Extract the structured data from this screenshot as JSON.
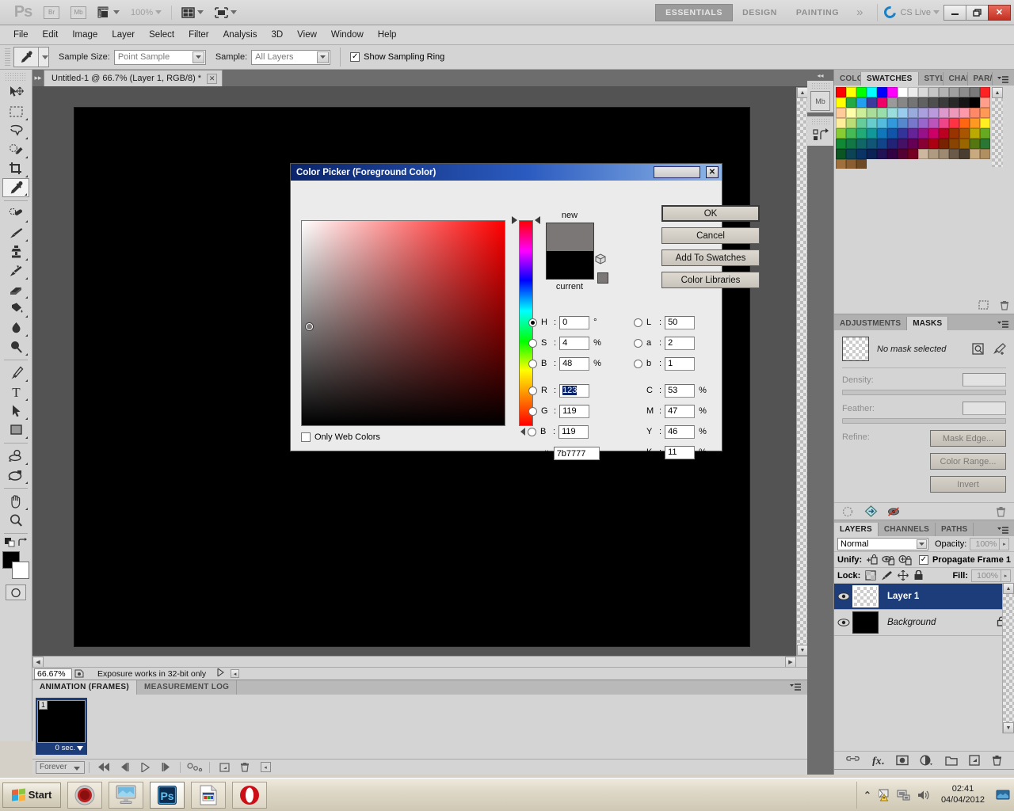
{
  "appbar": {
    "logo": "Ps",
    "bridge_btn": "Br",
    "minibridge_btn": "Mb",
    "zoom_level": "100%",
    "workspaces": [
      {
        "label": "ESSENTIALS",
        "active": true
      },
      {
        "label": "DESIGN",
        "active": false
      },
      {
        "label": "PAINTING",
        "active": false
      }
    ],
    "more_workspaces": "»",
    "cs_live": "CS Live",
    "window_buttons": {
      "minimize": "—",
      "restore": "❐",
      "close": "✕"
    }
  },
  "menubar": {
    "items": [
      "File",
      "Edit",
      "Image",
      "Layer",
      "Select",
      "Filter",
      "Analysis",
      "3D",
      "View",
      "Window",
      "Help"
    ]
  },
  "options_bar": {
    "tool": "eyedropper-tool",
    "sample_size_label": "Sample Size:",
    "sample_size_value": "Point Sample",
    "sample_label": "Sample:",
    "sample_value": "All Layers",
    "show_sampling_ring_label": "Show Sampling Ring",
    "show_sampling_ring_checked": true
  },
  "toolbar": {
    "tools": [
      {
        "name": "move-tool",
        "selected": false,
        "has_submenu": false
      },
      {
        "name": "rectangular-marquee-tool",
        "selected": false,
        "has_submenu": true
      },
      {
        "name": "lasso-tool",
        "selected": false,
        "has_submenu": true
      },
      {
        "name": "quick-selection-tool",
        "selected": false,
        "has_submenu": true
      },
      {
        "name": "crop-tool",
        "selected": false,
        "has_submenu": true
      },
      {
        "name": "eyedropper-tool",
        "selected": true,
        "has_submenu": true
      },
      {
        "name": "spot-healing-brush-tool",
        "selected": false,
        "has_submenu": true
      },
      {
        "name": "brush-tool",
        "selected": false,
        "has_submenu": true
      },
      {
        "name": "clone-stamp-tool",
        "selected": false,
        "has_submenu": true
      },
      {
        "name": "history-brush-tool",
        "selected": false,
        "has_submenu": true
      },
      {
        "name": "eraser-tool",
        "selected": false,
        "has_submenu": true
      },
      {
        "name": "gradient-tool",
        "selected": false,
        "has_submenu": true
      },
      {
        "name": "blur-tool",
        "selected": false,
        "has_submenu": true
      },
      {
        "name": "dodge-tool",
        "selected": false,
        "has_submenu": true
      },
      {
        "name": "pen-tool",
        "selected": false,
        "has_submenu": true
      },
      {
        "name": "type-tool",
        "selected": false,
        "has_submenu": true
      },
      {
        "name": "path-selection-tool",
        "selected": false,
        "has_submenu": true
      },
      {
        "name": "rectangle-shape-tool",
        "selected": false,
        "has_submenu": true
      },
      {
        "name": "3d-object-rotate-tool",
        "selected": false,
        "has_submenu": true
      },
      {
        "name": "3d-camera-rotate-tool",
        "selected": false,
        "has_submenu": true
      },
      {
        "name": "hand-tool",
        "selected": false,
        "has_submenu": true
      },
      {
        "name": "zoom-tool",
        "selected": false,
        "has_submenu": false
      }
    ],
    "foreground_color": "#000000",
    "background_color": "#ffffff"
  },
  "document": {
    "tab_title": "Untitled-1 @ 66.7% (Layer 1, RGB/8) *",
    "close_label": "✕",
    "canvas_color": "#000000"
  },
  "statusbar": {
    "zoom_value": "66.67%",
    "message": "Exposure works in 32-bit only"
  },
  "animation_panel": {
    "tabs": [
      {
        "label": "ANIMATION (FRAMES)",
        "active": true
      },
      {
        "label": "MEASUREMENT LOG",
        "active": false
      }
    ],
    "frames": [
      {
        "number": "1",
        "duration": "0 sec.",
        "thumb_color": "#000000",
        "selected": true
      }
    ],
    "loop_value": "Forever",
    "buttons": [
      "select-first-frame",
      "select-previous-frame",
      "play-animation",
      "select-next-frame",
      "tween-frames",
      "duplicate-frame",
      "delete-frame",
      "convert-to-timeline"
    ]
  },
  "mini_dock": {
    "collapse_label": "◂◂",
    "buttons": [
      "mini-bridge",
      "history"
    ]
  },
  "swatches_panel": {
    "tabs": [
      {
        "label": "COLO",
        "active": false
      },
      {
        "label": "SWATCHES",
        "active": true
      },
      {
        "label": "STYL",
        "active": false
      },
      {
        "label": "CHAI",
        "active": false
      },
      {
        "label": "PAR/",
        "active": false
      }
    ],
    "colors": [
      "#ff0000",
      "#ffff00",
      "#00ff00",
      "#00ffff",
      "#0000ff",
      "#ff00ff",
      "#ffffff",
      "#ececec",
      "#d9d9d9",
      "#c6c6c6",
      "#b3b3b3",
      "#a0a0a0",
      "#8d8d8d",
      "#7a7a7a",
      "#ff2222",
      "#ffff00",
      "#22aa44",
      "#22a0ee",
      "#3b3b9e",
      "#ee0066",
      "#9a9a9a",
      "#878787",
      "#747474",
      "#616161",
      "#4e4e4e",
      "#3b3b3b",
      "#282828",
      "#151515",
      "#000000",
      "#ff9e8a",
      "#ffcc99",
      "#ffffaa",
      "#ccee99",
      "#aadd99",
      "#99ddaa",
      "#99dddd",
      "#99ccee",
      "#99aadd",
      "#aaa0dd",
      "#bb99dd",
      "#dd99cc",
      "#ee99bb",
      "#ff99aa",
      "#ff8866",
      "#ff9955",
      "#ffee99",
      "#bbdd77",
      "#66cc99",
      "#66cccc",
      "#55bbdd",
      "#3399dd",
      "#5588cc",
      "#7777cc",
      "#9966cc",
      "#bb55bb",
      "#ee4488",
      "#ff3344",
      "#ff6611",
      "#ff9922",
      "#ffee22",
      "#88cc33",
      "#44bb55",
      "#22aa77",
      "#119999",
      "#1177bb",
      "#1155aa",
      "#333399",
      "#662299",
      "#991188",
      "#cc0066",
      "#bb0022",
      "#993300",
      "#aa5500",
      "#bbaa00",
      "#66aa22",
      "#118833",
      "#117744",
      "#116666",
      "#115577",
      "#114488",
      "#222277",
      "#441166",
      "#660055",
      "#880033",
      "#aa0011",
      "#772200",
      "#884400",
      "#996600",
      "#557711",
      "#2a7733",
      "#0a5522",
      "#0a4455",
      "#0a3366",
      "#0a2255",
      "#221155",
      "#330044",
      "#550033",
      "#770022",
      "#cdb79e",
      "#b09a80",
      "#9e8a70",
      "#6b5a48",
      "#4a3e30",
      "#c9a97e",
      "#b08f60",
      "#a0703c",
      "#8a5e30",
      "#6e4a24"
    ]
  },
  "masks_panel": {
    "tabs": [
      {
        "label": "ADJUSTMENTS",
        "active": false
      },
      {
        "label": "MASKS",
        "active": true
      }
    ],
    "status": "No mask selected",
    "density_label": "Density:",
    "density_value": "",
    "feather_label": "Feather:",
    "feather_value": "",
    "refine_label": "Refine:",
    "buttons": [
      {
        "label": "Mask Edge...",
        "name": "mask-edge-button"
      },
      {
        "label": "Color Range...",
        "name": "color-range-button"
      },
      {
        "label": "Invert",
        "name": "invert-button"
      }
    ],
    "footer_icons": [
      "load-selection-icon",
      "apply-mask-icon",
      "disable-mask-icon",
      "delete-mask-icon"
    ]
  },
  "layers_panel": {
    "tabs": [
      {
        "label": "LAYERS",
        "active": true
      },
      {
        "label": "CHANNELS",
        "active": false
      },
      {
        "label": "PATHS",
        "active": false
      }
    ],
    "blend_mode": "Normal",
    "opacity_label": "Opacity:",
    "opacity_value": "100%",
    "unify_label": "Unify:",
    "propagate_label": "Propagate Frame 1",
    "propagate_checked": true,
    "lock_label": "Lock:",
    "fill_label": "Fill:",
    "fill_value": "100%",
    "layers": [
      {
        "name": "Layer 1",
        "selected": true,
        "visible": true,
        "locked": false,
        "thumb": "transparent"
      },
      {
        "name": "Background",
        "selected": false,
        "visible": true,
        "locked": true,
        "thumb": "#000000"
      }
    ],
    "footer_icons": [
      "link-layers-icon",
      "layer-style-icon",
      "layer-mask-icon",
      "adjustment-layer-icon",
      "new-group-icon",
      "new-layer-icon",
      "delete-layer-icon"
    ]
  },
  "color_picker": {
    "title": "Color Picker (Foreground Color)",
    "close_label": "✕",
    "new_label": "new",
    "current_label": "current",
    "new_color": "#7b7777",
    "current_color": "#000000",
    "only_web_colors_label": "Only Web Colors",
    "only_web_colors_checked": false,
    "buttons": [
      {
        "label": "OK",
        "name": "ok-button",
        "primary": true
      },
      {
        "label": "Cancel",
        "name": "cancel-button",
        "primary": false
      },
      {
        "label": "Add To Swatches",
        "name": "add-to-swatches-button",
        "primary": false
      },
      {
        "label": "Color Libraries",
        "name": "color-libraries-button",
        "primary": false
      }
    ],
    "hsb": [
      {
        "key": "H",
        "value": "0",
        "unit": "°",
        "selected": true
      },
      {
        "key": "S",
        "value": "4",
        "unit": "%",
        "selected": false
      },
      {
        "key": "B",
        "value": "48",
        "unit": "%",
        "selected": false
      }
    ],
    "rgb": [
      {
        "key": "R",
        "value": "123",
        "unit": "",
        "selected": false,
        "highlighted": true
      },
      {
        "key": "G",
        "value": "119",
        "unit": "",
        "selected": false,
        "highlighted": false
      },
      {
        "key": "B",
        "value": "119",
        "unit": "",
        "selected": false,
        "highlighted": false
      }
    ],
    "lab": [
      {
        "key": "L",
        "value": "50",
        "unit": "",
        "selected": false
      },
      {
        "key": "a",
        "value": "2",
        "unit": "",
        "selected": false
      },
      {
        "key": "b",
        "value": "1",
        "unit": "",
        "selected": false
      }
    ],
    "cmyk": [
      {
        "key": "C",
        "value": "53",
        "unit": "%"
      },
      {
        "key": "M",
        "value": "47",
        "unit": "%"
      },
      {
        "key": "Y",
        "value": "46",
        "unit": "%"
      },
      {
        "key": "K",
        "value": "11",
        "unit": "%"
      }
    ],
    "hex_prefix": "#",
    "hex_value": "7b7777",
    "marker_x_pct": 4,
    "marker_y_pct": 52,
    "hue_pointer_pct": 0
  },
  "taskbar": {
    "start_label": "Start",
    "items": [
      {
        "name": "taskbar-record-item",
        "active": false
      },
      {
        "name": "taskbar-desktop-item",
        "active": false
      },
      {
        "name": "taskbar-photoshop-item",
        "active": true
      },
      {
        "name": "taskbar-document-item",
        "active": false
      },
      {
        "name": "taskbar-opera-item",
        "active": false
      }
    ],
    "tray": {
      "time": "02:41",
      "date": "04/04/2012",
      "icons": [
        "show-hidden-icons",
        "network-warning-icon",
        "network-icon",
        "volume-icon",
        "display-icon"
      ]
    }
  }
}
